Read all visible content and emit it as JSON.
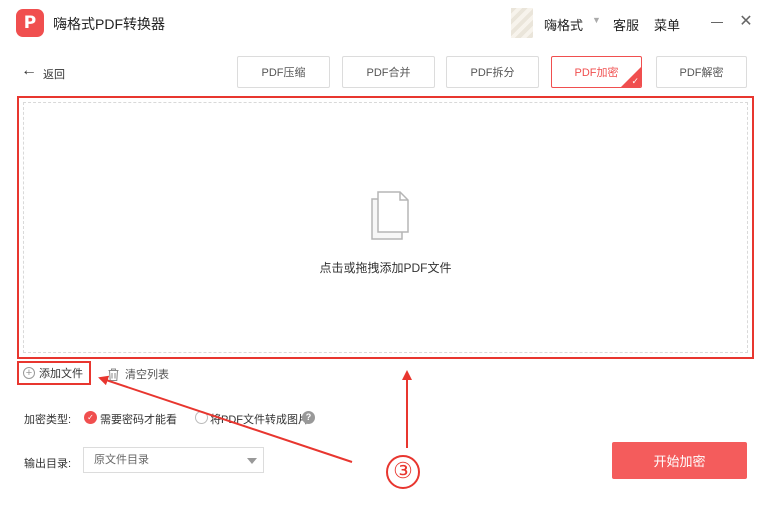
{
  "app": {
    "title": "嗨格式PDF转换器",
    "logo_letter": "P"
  },
  "header": {
    "username": "嗨格式",
    "service": "客服",
    "menu": "菜单",
    "close_glyph": "✕"
  },
  "nav": {
    "back_label": "返回",
    "back_glyph": "←"
  },
  "tabs": [
    {
      "label": "PDF压缩",
      "active": false
    },
    {
      "label": "PDF合并",
      "active": false
    },
    {
      "label": "PDF拆分",
      "active": false
    },
    {
      "label": "PDF加密",
      "active": true
    },
    {
      "label": "PDF解密",
      "active": false
    }
  ],
  "dropzone": {
    "label": "点击或拖拽添加PDF文件"
  },
  "file_actions": {
    "add_file": "添加文件",
    "clear_list": "清空列表"
  },
  "encryption": {
    "type_label": "加密类型:",
    "options": [
      {
        "label": "需要密码才能看",
        "selected": true
      },
      {
        "label": "将PDF文件转成图片",
        "selected": false
      }
    ],
    "help_glyph": "?"
  },
  "output": {
    "label": "输出目录:",
    "selected": "原文件目录"
  },
  "start_button": {
    "label": "开始加密"
  },
  "annotation": {
    "step_marker": "③"
  },
  "colors": {
    "accent": "#f04f4f",
    "annotation_red": "#e8362f",
    "button_bg": "#f45c5c"
  }
}
